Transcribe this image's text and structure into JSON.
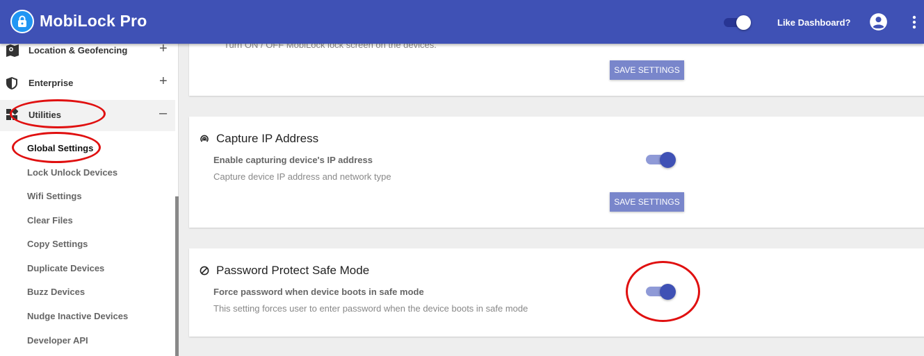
{
  "header": {
    "app_title": "MobiLock Pro",
    "like_dashboard": "Like Dashboard?",
    "colors": {
      "bar": "#3f51b5",
      "logo": "#2196f3"
    }
  },
  "sidebar": {
    "items": [
      {
        "label": "Location & Geofencing",
        "toggle": "+"
      },
      {
        "label": "Enterprise",
        "toggle": "+"
      },
      {
        "label": "Utilities",
        "toggle": "–"
      }
    ],
    "sub_items": [
      "Global Settings",
      "Lock Unlock Devices",
      "Wifi Settings",
      "Clear Files",
      "Copy Settings",
      "Duplicate Devices",
      "Buzz Devices",
      "Nudge Inactive Devices",
      "Developer API"
    ]
  },
  "cards": {
    "lock_screen": {
      "desc": "Turn ON / OFF MobiLock lock screen on the devices.",
      "save_label": "SAVE SETTINGS"
    },
    "capture_ip": {
      "title": "Capture IP Address",
      "label": "Enable capturing device's IP address",
      "desc": "Capture device IP address and network type",
      "save_label": "SAVE SETTINGS",
      "enabled": true
    },
    "safe_mode": {
      "title": "Password Protect Safe Mode",
      "label": "Force password when device boots in safe mode",
      "desc": "This setting forces user to enter password when the device boots in safe mode",
      "enabled": true
    }
  },
  "accent_color": "#3f51b5",
  "annotation_color": "#e01010"
}
